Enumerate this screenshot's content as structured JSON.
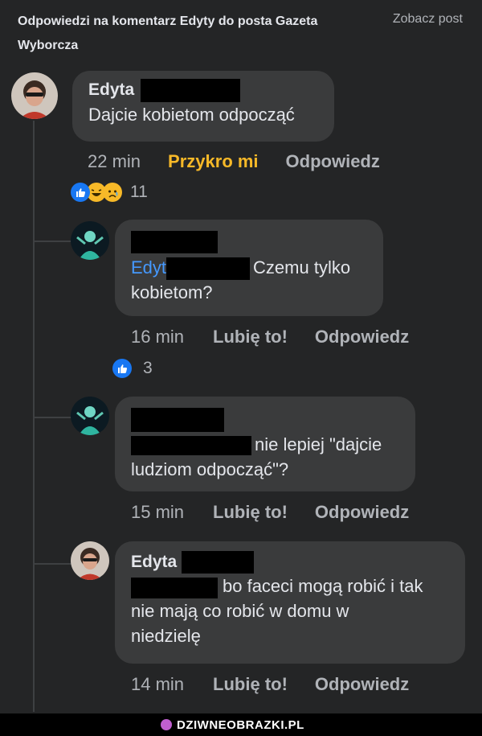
{
  "header": {
    "title": "Odpowiedzi na komentarz Edyty do posta Gazeta Wyborcza",
    "view_post": "Zobacz post"
  },
  "comments": [
    {
      "author": "Edyta",
      "text": "Dajcie kobietom odpocząć",
      "time": "22 min",
      "reaction_label": "Przykro mi",
      "reply": "Odpowiedz",
      "reaction_count": "11",
      "reaction_icons": [
        "like-icon",
        "haha-icon",
        "sad-icon"
      ]
    },
    {
      "mention": "Edyt",
      "text": "Czemu tylko kobietom?",
      "text_line1": "Czemu tylko",
      "text_line2": "kobietom?",
      "time": "16 min",
      "like": "Lubię to!",
      "reply": "Odpowiedz",
      "reaction_count": "3",
      "reaction_icons": [
        "like-icon"
      ]
    },
    {
      "text": "nie lepiej \"dajcie ludziom odpocząć\"?",
      "text_line1": "nie lepiej \"dajcie",
      "text_line2": "ludziom odpocząć\"?",
      "time": "15 min",
      "like": "Lubię to!",
      "reply": "Odpowiedz"
    },
    {
      "author": "Edyta",
      "text": "bo faceci mogą robić i tak nie mają co robić w domu w niedzielę",
      "text_line1": "bo faceci mogą robić i tak",
      "text_line2": "nie mają co robić w domu w",
      "text_line3": "niedzielę",
      "time": "14 min",
      "like": "Lubię to!",
      "reply": "Odpowiedz"
    }
  ],
  "watermark": "DZIWNEOBRAZKI.PL",
  "colors": {
    "background": "#242526",
    "bubble": "#3a3b3c",
    "mention": "#4599ff",
    "sad_reaction": "#f7b928",
    "like_blue": "#1877f2"
  }
}
